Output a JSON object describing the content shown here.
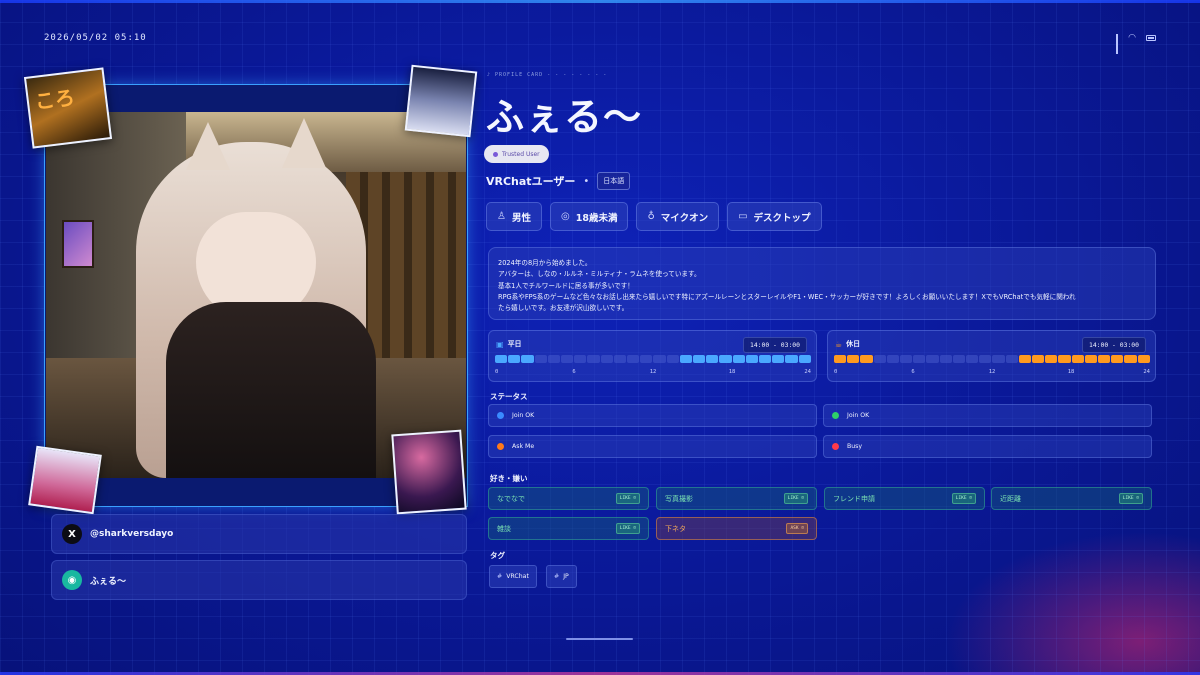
{
  "status_bar": {
    "datetime": "2026/05/02 05:10"
  },
  "profile": {
    "section_label": "PROFILE CARD",
    "name": "ふぇる〜",
    "trust_badge": "Trusted User",
    "user_type": "VRChatユーザー",
    "language": "日本語",
    "attributes": [
      {
        "icon": "person-icon",
        "label": "男性"
      },
      {
        "icon": "age-icon",
        "label": "18歳未満"
      },
      {
        "icon": "microphone-icon",
        "label": "マイクオン"
      },
      {
        "icon": "monitor-icon",
        "label": "デスクトップ"
      }
    ],
    "bio": [
      "2024年の8月から始めました。",
      "アバターは、しなの・ルルネ・ミルティナ・ラムネを使っています。",
      "基本1人でチルワールドに居る事が多いです！",
      "RPG系やFPS系のゲームなど色々なお話し出来たら嬉しいです特にアズールレーンとスターレイルやF1・WEC・サッカーが好きです！よろしくお願いいたします！XでもVRChatでも気軽に関われ",
      "たら嬉しいです。お友達が沢山欲しいです。"
    ]
  },
  "schedule": {
    "weekday": {
      "label": "平日",
      "time": "14:00 - 03:00",
      "color": "#4aa8ff",
      "active_hours": [
        0,
        1,
        2,
        14,
        15,
        16,
        17,
        18,
        19,
        20,
        21,
        22,
        23
      ]
    },
    "holiday": {
      "label": "休日",
      "time": "14:00 - 03:00",
      "color": "#ff9a1f",
      "active_hours": [
        0,
        1,
        2,
        14,
        15,
        16,
        17,
        18,
        19,
        20,
        21,
        22,
        23
      ]
    },
    "ticks": [
      "0",
      "6",
      "12",
      "18",
      "24"
    ]
  },
  "status_section": {
    "title": "ステータス",
    "items": [
      {
        "label": "Join OK",
        "color": "#3a8bff"
      },
      {
        "label": "Join OK",
        "color": "#2ecf6a"
      },
      {
        "label": "Ask Me",
        "color": "#ff7a1a"
      },
      {
        "label": "Busy",
        "color": "#ff3a4a"
      }
    ]
  },
  "likes_section": {
    "title": "好き・嫌い",
    "items": [
      {
        "label": "なでなで",
        "badge": "LIKE ☺",
        "type": "like"
      },
      {
        "label": "写真撮影",
        "badge": "LIKE ☺",
        "type": "like"
      },
      {
        "label": "フレンド申請",
        "badge": "LIKE ☺",
        "type": "like"
      },
      {
        "label": "近距離",
        "badge": "LIKE ☺",
        "type": "like"
      },
      {
        "label": "雑談",
        "badge": "LIKE ☺",
        "type": "like"
      },
      {
        "label": "下ネタ",
        "badge": "ASK ☺",
        "type": "ask"
      }
    ]
  },
  "tags_section": {
    "title": "タグ",
    "items": [
      "VRChat",
      "JP"
    ]
  },
  "socials": [
    {
      "icon": "x-logo-icon",
      "glyph": "X",
      "label": "@sharkversdayo"
    },
    {
      "icon": "gamepad-icon",
      "glyph": "◉",
      "label": "ふぇる〜"
    }
  ],
  "thumbnails": {
    "t1_text": "ころ"
  }
}
